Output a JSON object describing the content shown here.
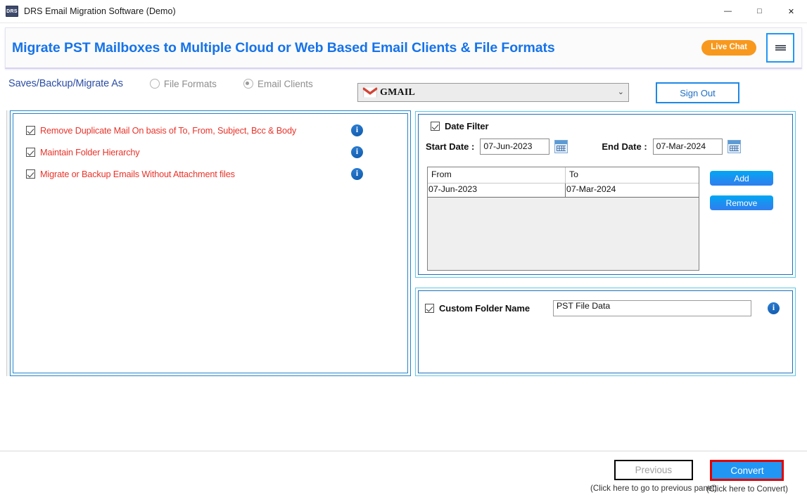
{
  "window": {
    "title": "DRS Email Migration Software (Demo)",
    "app_icon": "DRS",
    "minimize": "—",
    "maximize": "□",
    "close": "✕"
  },
  "banner": {
    "title": "Migrate PST Mailboxes to Multiple Cloud or Web Based Email Clients & File Formats",
    "live_chat": "Live Chat",
    "title_color": "#1673e8",
    "live_chat_color": "#f8981d"
  },
  "options_bar": {
    "label": "Saves/Backup/Migrate As",
    "radios": [
      {
        "label": "File Formats",
        "selected": false
      },
      {
        "label": "Email Clients",
        "selected": true
      }
    ],
    "target_select": {
      "value": "GMAIL",
      "icon": "gmail-icon",
      "arrow": "⌄"
    },
    "sign_out": "Sign Out"
  },
  "left_panel": {
    "options": [
      {
        "label": "Remove Duplicate Mail On basis of To, From, Subject, Bcc & Body",
        "checked": true
      },
      {
        "label": "Maintain Folder Hierarchy",
        "checked": true
      },
      {
        "label": "Migrate or Backup Emails Without Attachment files",
        "checked": true
      }
    ],
    "info_glyph": "i",
    "text_color": "#e8342a"
  },
  "date_filter": {
    "title": "Date Filter",
    "checked": true,
    "start_label": "Start Date :",
    "start_value": "07-Jun-2023",
    "end_label": "End Date :",
    "end_value": "07-Mar-2024",
    "grid": {
      "columns": [
        "From",
        "To"
      ],
      "rows": [
        {
          "from": "07-Jun-2023",
          "to": "07-Mar-2024"
        }
      ]
    },
    "add_label": "Add",
    "remove_label": "Remove"
  },
  "custom_folder": {
    "title": "Custom Folder Name",
    "checked": true,
    "value": "PST File Data",
    "info_glyph": "i"
  },
  "footer": {
    "previous_label": "Previous",
    "previous_hint": "(Click here to go to previous panel)",
    "convert_label": "Convert",
    "convert_hint": "(Click here to Convert)",
    "convert_bg": "#2196f3",
    "convert_border": "#e00000"
  }
}
